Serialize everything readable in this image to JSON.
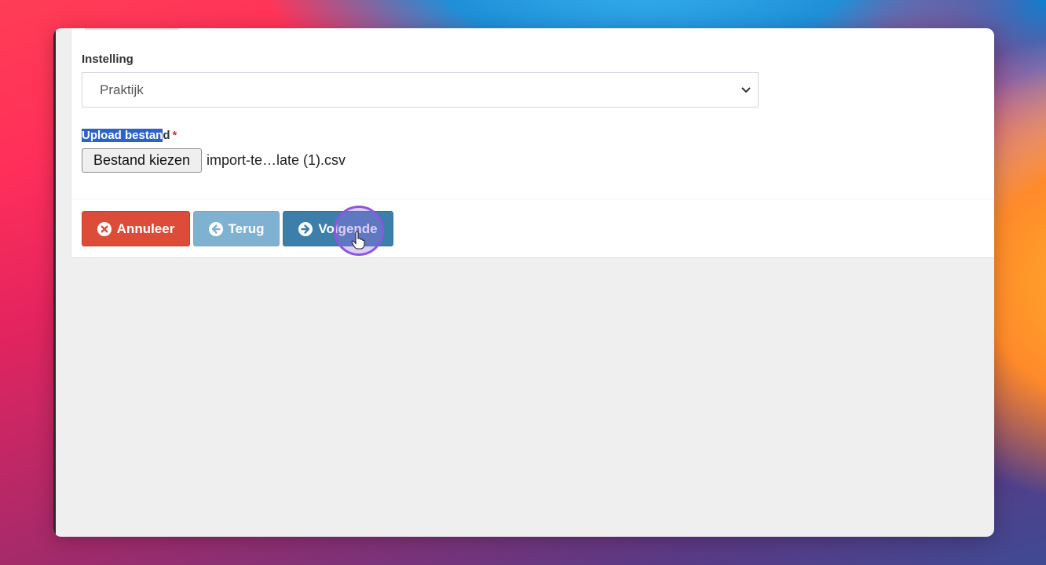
{
  "form": {
    "setting_label": "Instelling",
    "setting_value": "Praktijk",
    "upload_label_highlighted": "Upload bestan",
    "upload_label_rest": "d",
    "required_marker": "*",
    "file_button_label": "Bestand kiezen",
    "file_name": "import-te…late (1).csv"
  },
  "actions": {
    "cancel_label": "Annuleer",
    "back_label": "Terug",
    "next_label": "Volgende"
  },
  "icons": {
    "cancel": "times-circle-icon",
    "back": "arrow-circle-left-icon",
    "next": "arrow-circle-right-icon",
    "select": "chevron-down-icon",
    "cursor": "hand-pointer-icon"
  },
  "colors": {
    "cancel": "#dd4b39",
    "back": "#7fb2d1",
    "next": "#3c7faa",
    "highlight": "#2b63c6",
    "required": "#c0392b"
  }
}
